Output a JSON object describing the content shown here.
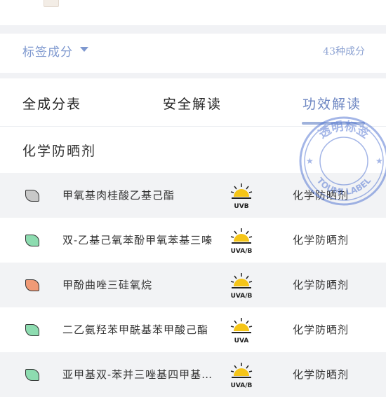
{
  "label_section": {
    "title": "标签成分",
    "count": "43种成分"
  },
  "tabs": [
    {
      "label": "全成分表",
      "active": false
    },
    {
      "label": "安全解读",
      "active": false
    },
    {
      "label": "功效解读",
      "active": true
    }
  ],
  "category": {
    "title": "化学防晒剂"
  },
  "ingredients": [
    {
      "name": "甲氧基肉桂酸乙基己酯",
      "uv": "UVB",
      "function": "化学防晒剂",
      "leaf_color": "#c8c8c8"
    },
    {
      "name": "双-乙基己氧苯酚甲氧苯基三嗪",
      "uv": "UVA/B",
      "function": "化学防晒剂",
      "leaf_color": "#8ddcb0"
    },
    {
      "name": "甲酚曲唑三硅氧烷",
      "uv": "UVA/B",
      "function": "化学防晒剂",
      "leaf_color": "#f09a76"
    },
    {
      "name": "二乙氨羟苯甲酰基苯甲酸己酯",
      "uv": "UVA",
      "function": "化学防晒剂",
      "leaf_color": "#8ddcb0"
    },
    {
      "name": "亚甲基双-苯并三唑基四甲基…",
      "uv": "UVA/B",
      "function": "化学防晒剂",
      "leaf_color": "#8ddcb0"
    }
  ],
  "watermark": {
    "text_top": "透明标签",
    "text_bottom": "TOUMI LABEL"
  },
  "colors": {
    "accent": "#7e98cf",
    "sun": "#f5c518"
  }
}
